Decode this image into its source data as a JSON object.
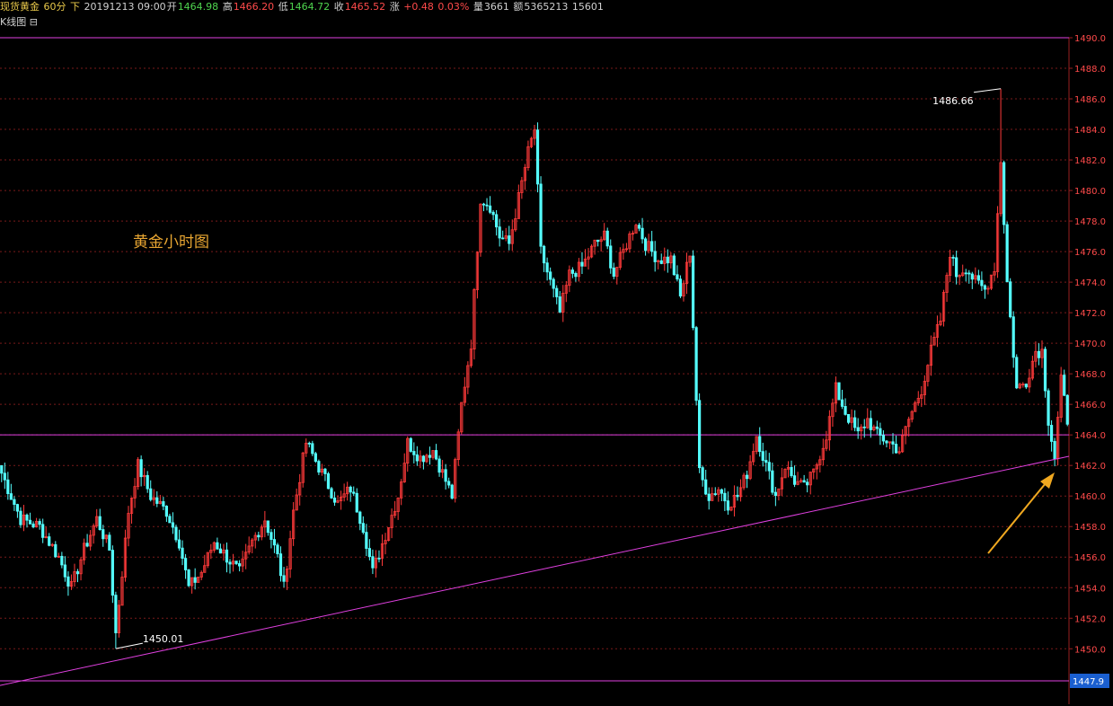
{
  "header": {
    "instrument": "现货黄金",
    "period": "60分",
    "direction": "下",
    "datetime": "20191213 09:00",
    "open_label": "开",
    "open": "1464.98",
    "high_label": "高",
    "high": "1466.20",
    "low_label": "低",
    "low": "1464.72",
    "close_label": "收",
    "close": "1465.52",
    "change_label": "涨",
    "change": "+0.48",
    "change_pct": "0.03%",
    "volume_label": "量",
    "volume": "3661",
    "amount_label": "额",
    "amount": "5365213",
    "extra": "15601"
  },
  "subtitle": "K线图",
  "chart_data": {
    "type": "candlestick",
    "title": "黄金小时图",
    "ylim": [
      1447.9,
      1490.0
    ],
    "y_ticks": [
      "1490.0",
      "1488.0",
      "1486.0",
      "1484.0",
      "1482.0",
      "1480.0",
      "1478.0",
      "1476.0",
      "1474.0",
      "1472.0",
      "1470.0",
      "1468.0",
      "1466.0",
      "1464.0",
      "1462.0",
      "1460.0",
      "1458.0",
      "1456.0",
      "1454.0",
      "1452.0",
      "1450.0"
    ],
    "current_price_tag": "1447.9",
    "grid": true,
    "annotations": {
      "high": "1486.66",
      "low": "1450.01"
    },
    "horizontal_lines": [
      1490.0,
      1464.0,
      1447.9
    ],
    "trendline": {
      "from": 1447.6,
      "to": 1462.6
    },
    "colors": {
      "up": "#ff3a3a",
      "down": "#54ffff",
      "line": "#e040e0",
      "arrow": "#f0a820",
      "grid": "#7a1a1a"
    },
    "anchors": [
      [
        0,
        1461.5
      ],
      [
        6,
        1458.5
      ],
      [
        12,
        1458.0
      ],
      [
        18,
        1456.0
      ],
      [
        22,
        1454.0
      ],
      [
        26,
        1456.5
      ],
      [
        30,
        1458.5
      ],
      [
        34,
        1456.5
      ],
      [
        36,
        1451.0
      ],
      [
        40,
        1459.0
      ],
      [
        43,
        1462.0
      ],
      [
        47,
        1460.0
      ],
      [
        52,
        1459.0
      ],
      [
        56,
        1457.0
      ],
      [
        59,
        1454.0
      ],
      [
        63,
        1455.0
      ],
      [
        67,
        1457.0
      ],
      [
        71,
        1456.0
      ],
      [
        75,
        1455.0
      ],
      [
        79,
        1457.0
      ],
      [
        83,
        1458.5
      ],
      [
        87,
        1456.0
      ],
      [
        89,
        1454.0
      ],
      [
        92,
        1459.0
      ],
      [
        96,
        1463.5
      ],
      [
        101,
        1461.5
      ],
      [
        106,
        1459.5
      ],
      [
        110,
        1460.5
      ],
      [
        114,
        1458.0
      ],
      [
        117,
        1455.0
      ],
      [
        121,
        1457.5
      ],
      [
        125,
        1460.0
      ],
      [
        128,
        1463.5
      ],
      [
        132,
        1462.5
      ],
      [
        136,
        1463.0
      ],
      [
        139,
        1461.5
      ],
      [
        142,
        1460.0
      ],
      [
        145,
        1466.0
      ],
      [
        148,
        1470.0
      ],
      [
        151,
        1479.5
      ],
      [
        154,
        1479.0
      ],
      [
        157,
        1477.0
      ],
      [
        160,
        1476.5
      ],
      [
        163,
        1479.5
      ],
      [
        166,
        1482.5
      ],
      [
        168,
        1484.0
      ],
      [
        170,
        1476.0
      ],
      [
        173,
        1474.0
      ],
      [
        176,
        1472.0
      ],
      [
        179,
        1474.5
      ],
      [
        183,
        1475.0
      ],
      [
        187,
        1476.5
      ],
      [
        190,
        1477.0
      ],
      [
        193,
        1474.5
      ],
      [
        196,
        1476.0
      ],
      [
        200,
        1478.0
      ],
      [
        203,
        1476.5
      ],
      [
        207,
        1475.5
      ],
      [
        211,
        1475.5
      ],
      [
        214,
        1473.0
      ],
      [
        217,
        1476.0
      ],
      [
        220,
        1461.5
      ],
      [
        223,
        1460.0
      ],
      [
        226,
        1460.5
      ],
      [
        229,
        1459.5
      ],
      [
        232,
        1460.0
      ],
      [
        235,
        1461.5
      ],
      [
        238,
        1464.0
      ],
      [
        241,
        1462.0
      ],
      [
        244,
        1460.0
      ],
      [
        247,
        1462.0
      ],
      [
        250,
        1461.0
      ],
      [
        253,
        1460.5
      ],
      [
        256,
        1461.5
      ],
      [
        260,
        1464.0
      ],
      [
        263,
        1467.0
      ],
      [
        266,
        1465.5
      ],
      [
        270,
        1464.0
      ],
      [
        273,
        1465.0
      ],
      [
        276,
        1464.0
      ],
      [
        280,
        1463.5
      ],
      [
        283,
        1463.0
      ],
      [
        286,
        1465.0
      ],
      [
        290,
        1467.0
      ],
      [
        293,
        1469.5
      ],
      [
        296,
        1471.5
      ],
      [
        299,
        1476.0
      ],
      [
        301,
        1474.5
      ],
      [
        304,
        1475.0
      ],
      [
        307,
        1474.0
      ],
      [
        310,
        1473.5
      ],
      [
        313,
        1475.0
      ],
      [
        315,
        1482.0
      ],
      [
        317,
        1474.0
      ],
      [
        320,
        1467.0
      ],
      [
        323,
        1467.5
      ],
      [
        326,
        1469.5
      ],
      [
        328,
        1469.5
      ],
      [
        330,
        1465.0
      ],
      [
        332,
        1462.5
      ],
      [
        334,
        1467.5
      ],
      [
        336,
        1465.0
      ]
    ]
  },
  "labels": {
    "high_note": "1486.66",
    "low_note": "1450.01",
    "caption": "黄金小时图",
    "price_tag": "1447.9"
  }
}
